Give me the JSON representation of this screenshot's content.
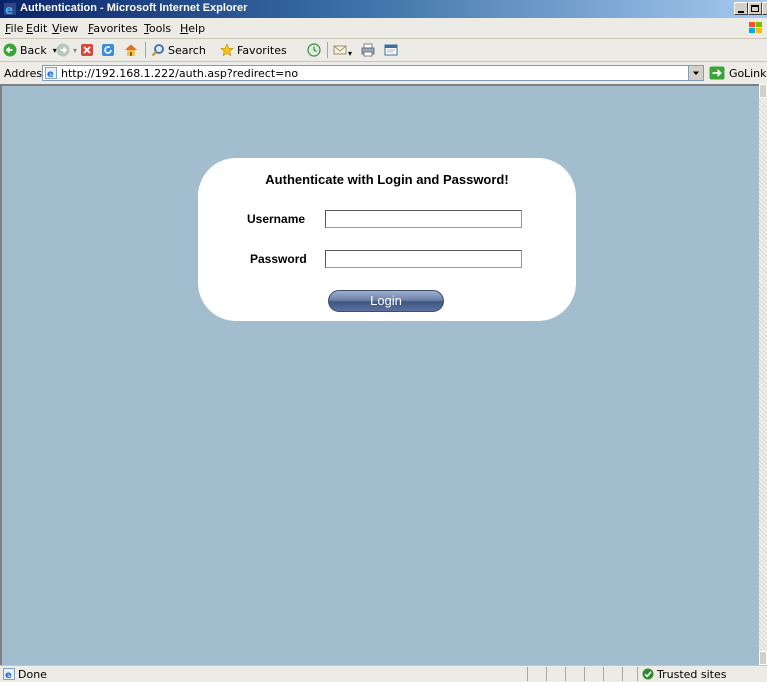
{
  "window": {
    "title": "Authentication - Microsoft Internet Explorer"
  },
  "menu": {
    "items": [
      "File",
      "Edit",
      "View",
      "Favorites",
      "Tools",
      "Help"
    ]
  },
  "toolbar": {
    "back_label": "Back",
    "search_label": "Search",
    "favorites_label": "Favorites"
  },
  "address": {
    "label": "Address",
    "url": "http://192.168.1.222/auth.asp?redirect=no",
    "go_label": "Go",
    "links_label": "Links"
  },
  "page": {
    "heading": "Authenticate with Login and Password!",
    "username_label": "Username",
    "username_value": "",
    "password_label": "Password",
    "password_value": "",
    "login_button": "Login",
    "background_color": "#a2bdcd"
  },
  "status": {
    "text": "Done",
    "zone": "Trusted sites"
  },
  "colors": {
    "title_bar": "#0a246a",
    "chrome": "#ecebe6",
    "accent": "#6d82a9"
  }
}
